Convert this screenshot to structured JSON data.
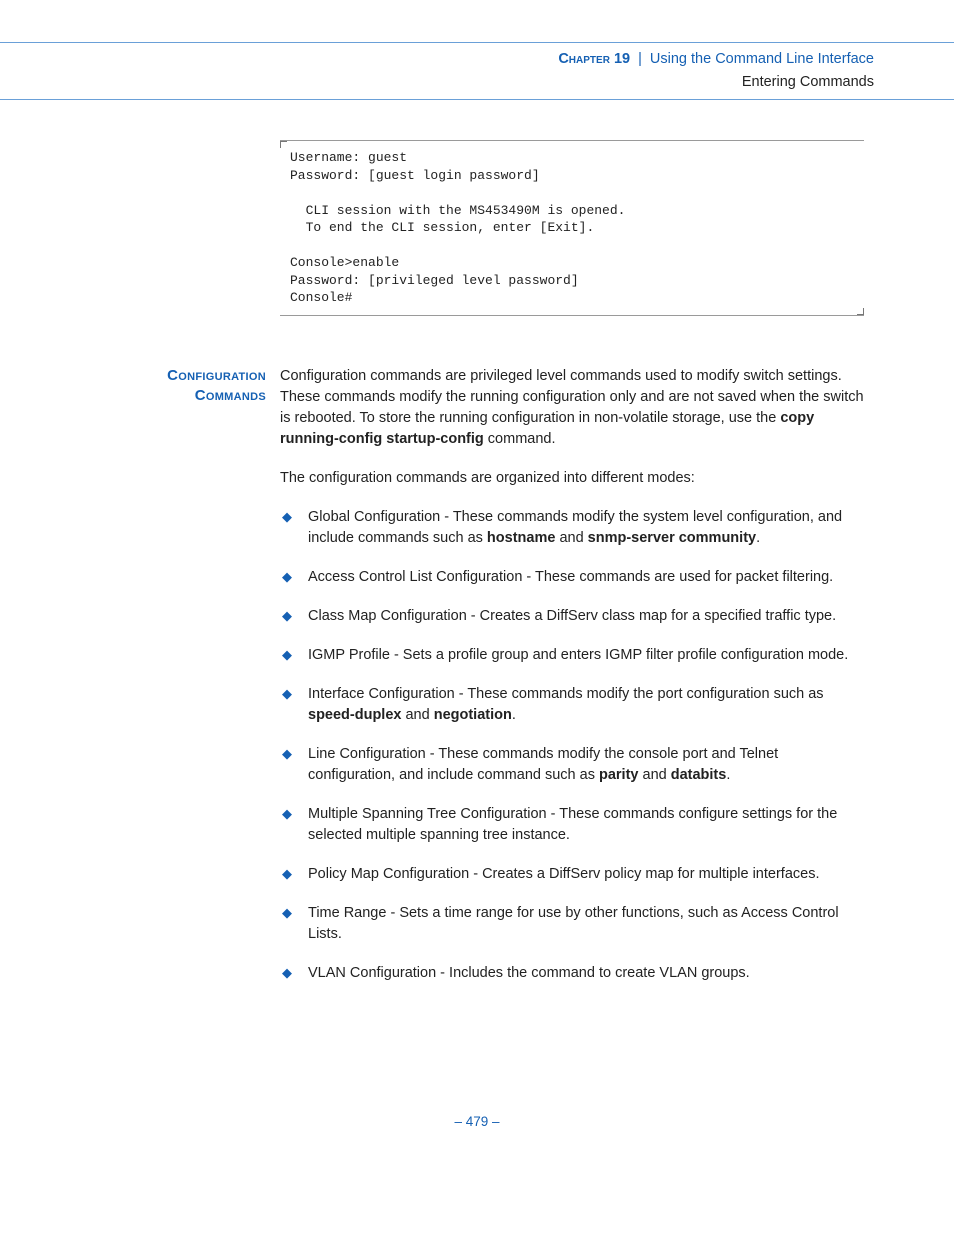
{
  "header": {
    "chapter_label": "Chapter 19",
    "divider": "|",
    "chapter_title": "Using the Command Line Interface",
    "section_title": "Entering Commands"
  },
  "codebox": {
    "text": "Username: guest\nPassword: [guest login password]\n\n  CLI session with the MS453490M is opened.\n  To end the CLI session, enter [Exit].\n\nConsole>enable\nPassword: [privileged level password]\nConsole#"
  },
  "section": {
    "heading_line1": "Configuration",
    "heading_line2": "Commands",
    "para1_pre": "Configuration commands are privileged level commands used to modify switch settings. These commands modify the running configuration only and are not saved when the switch is rebooted. To store the running configuration in non-volatile storage, use the ",
    "para1_bold": "copy running-config startup-config",
    "para1_post": " command.",
    "para2": "The configuration commands are organized into different modes:",
    "items": [
      {
        "pre": "Global Configuration - These commands modify the system level configuration, and include commands such as ",
        "b1": "hostname",
        "mid": " and ",
        "b2": "snmp-server community",
        "post": "."
      },
      {
        "pre": "Access Control List Configuration - These commands are used for packet filtering."
      },
      {
        "pre": "Class Map Configuration - Creates a DiffServ class map for a specified traffic type."
      },
      {
        "pre": "IGMP Profile - Sets a profile group and enters IGMP filter profile configuration mode."
      },
      {
        "pre": "Interface Configuration - These commands modify the port configuration such as ",
        "b1": "speed-duplex",
        "mid": " and ",
        "b2": "negotiation",
        "post": "."
      },
      {
        "pre": "Line Configuration - These commands modify the console port and Telnet configuration, and include command such as ",
        "b1": "parity",
        "mid": " and ",
        "b2": "databits",
        "post": "."
      },
      {
        "pre": "Multiple Spanning Tree Configuration - These commands configure settings for the selected multiple spanning tree instance."
      },
      {
        "pre": "Policy Map Configuration - Creates a DiffServ policy map for multiple interfaces."
      },
      {
        "pre": "Time Range - Sets a time range for use by other functions, such as Access Control Lists."
      },
      {
        "pre": "VLAN Configuration - Includes the command to create VLAN groups."
      }
    ]
  },
  "footer": {
    "page_label": "–  479  –"
  }
}
